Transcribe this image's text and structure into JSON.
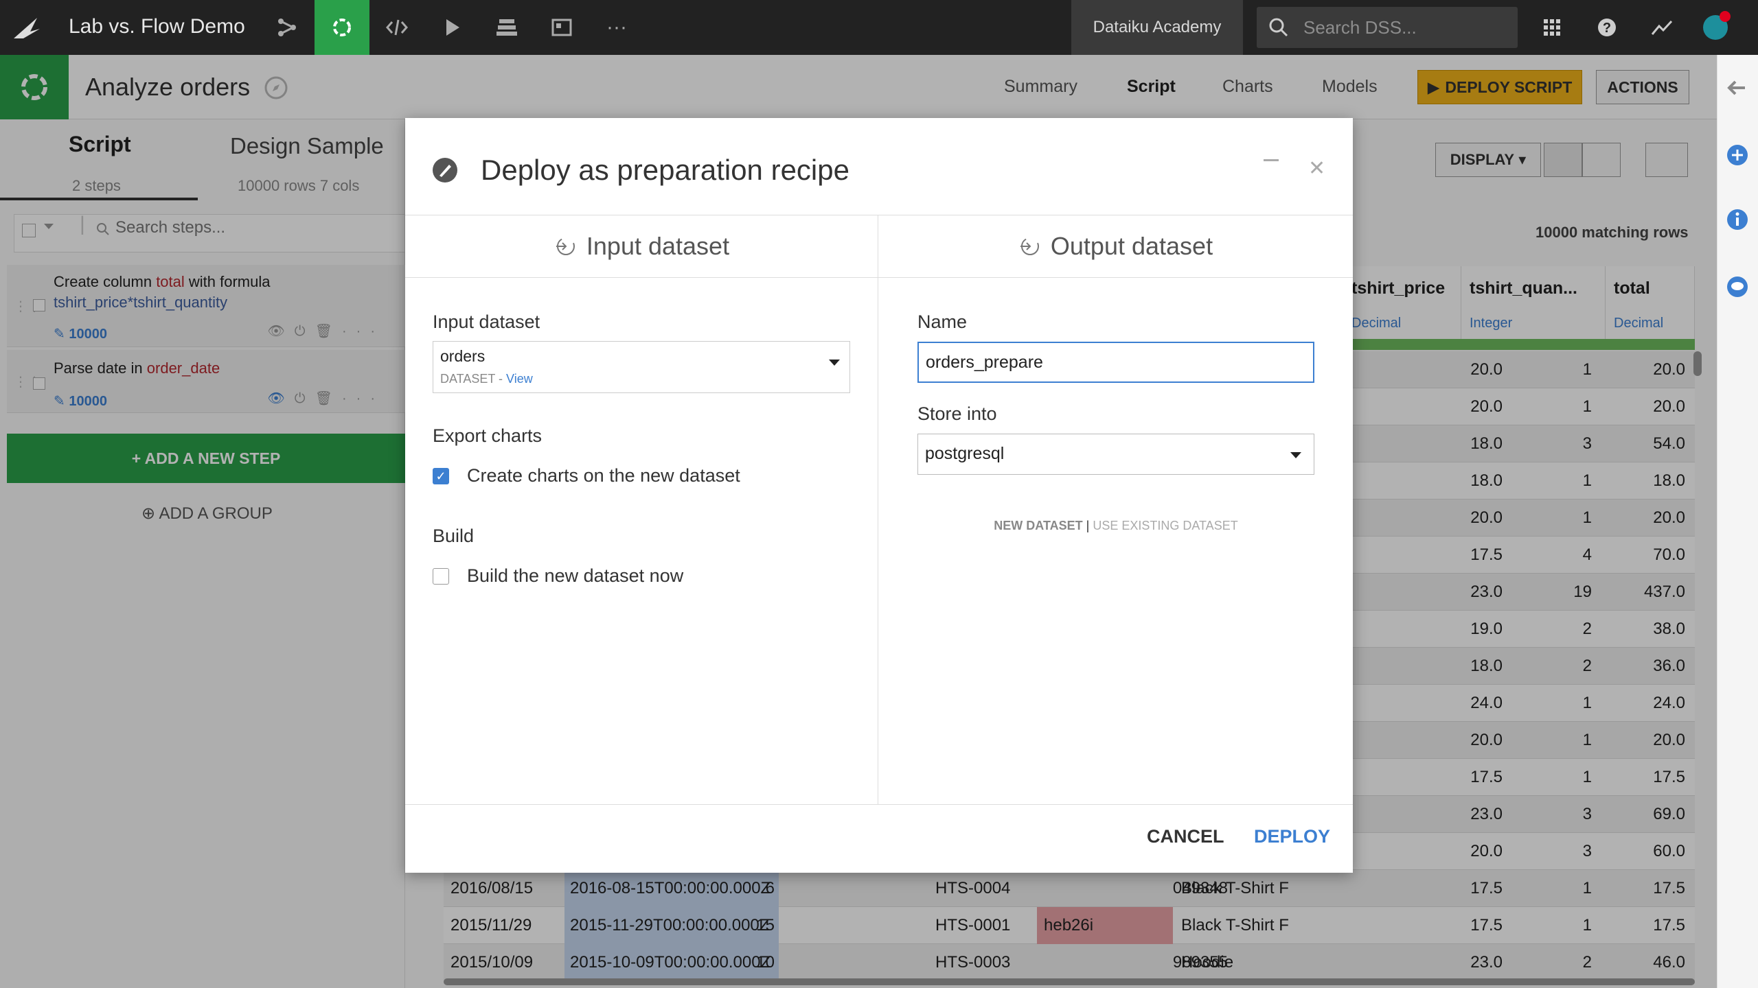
{
  "topbar": {
    "project_title": "Lab vs. Flow Demo",
    "academy": "Dataiku Academy",
    "search_placeholder": "Search DSS..."
  },
  "subbar": {
    "title": "Analyze orders",
    "tabs": [
      "Summary",
      "Script",
      "Charts",
      "Models"
    ],
    "deploy_script": "DEPLOY SCRIPT",
    "actions": "ACTIONS"
  },
  "left_panel": {
    "tab_script": "Script",
    "tab_design": "Design Sample",
    "steps_count": "2 steps",
    "rows_cols": "10000 rows 7 cols",
    "search_placeholder": "Search steps...",
    "step1": {
      "prefix": "Create column ",
      "col": "total",
      "mid": " with formula",
      "formula": "tshirt_price*tshirt_quantity",
      "count": "10000"
    },
    "step2": {
      "prefix": "Parse date",
      "mid": " in ",
      "col": "order_date",
      "count": "10000"
    },
    "add_step": "+ ADD A NEW STEP",
    "add_group": "ADD A GROUP"
  },
  "table": {
    "display": "DISPLAY",
    "matching_rows": "10000 matching rows",
    "columns": [
      {
        "name": "tshirt_price",
        "type": "Decimal"
      },
      {
        "name": "tshirt_quan...",
        "type": "Integer"
      },
      {
        "name": "total",
        "type": "Decimal"
      }
    ],
    "rows_right": [
      [
        "20.0",
        "1",
        "20.0"
      ],
      [
        "20.0",
        "1",
        "20.0"
      ],
      [
        "18.0",
        "3",
        "54.0"
      ],
      [
        "18.0",
        "1",
        "18.0"
      ],
      [
        "20.0",
        "1",
        "20.0"
      ],
      [
        "17.5",
        "4",
        "70.0"
      ],
      [
        "23.0",
        "19",
        "437.0"
      ],
      [
        "19.0",
        "2",
        "38.0"
      ],
      [
        "18.0",
        "2",
        "36.0"
      ],
      [
        "24.0",
        "1",
        "24.0"
      ],
      [
        "20.0",
        "1",
        "20.0"
      ],
      [
        "17.5",
        "1",
        "17.5"
      ],
      [
        "23.0",
        "3",
        "69.0"
      ],
      [
        "20.0",
        "3",
        "60.0"
      ]
    ],
    "rows_full": [
      [
        "2016/08/15",
        "2016-08-15T00:00:00.000Z",
        "6",
        "HTS-0004",
        "049348",
        "Black T-Shirt F",
        "17.5",
        "1",
        "17.5"
      ],
      [
        "2015/11/29",
        "2015-11-29T00:00:00.000Z",
        "15",
        "HTS-0001",
        "heb26i",
        "Black T-Shirt F",
        "17.5",
        "1",
        "17.5"
      ],
      [
        "2015/10/09",
        "2015-10-09T00:00:00.000Z",
        "10",
        "HTS-0003",
        "989355",
        "Hoodie",
        "23.0",
        "2",
        "46.0"
      ]
    ]
  },
  "modal": {
    "title": "Deploy as preparation recipe",
    "input_section": "Input dataset",
    "output_section": "Output dataset",
    "input_label": "Input dataset",
    "input_value": "orders",
    "input_sub": "DATASET",
    "input_view": "View",
    "export_label": "Export charts",
    "export_checkbox": "Create charts on the new dataset",
    "export_checked": true,
    "build_label": "Build",
    "build_checkbox": "Build the new dataset now",
    "build_checked": false,
    "name_label": "Name",
    "name_value": "orders_prepare",
    "store_label": "Store into",
    "store_value": "postgresql",
    "new_dataset": "NEW DATASET",
    "use_existing": "USE EXISTING DATASET",
    "cancel": "CANCEL",
    "deploy": "DEPLOY"
  },
  "colors": {
    "accent_green": "#2aa04a",
    "accent_blue": "#3c7fd1",
    "deploy_yellow": "#f0b21b"
  }
}
